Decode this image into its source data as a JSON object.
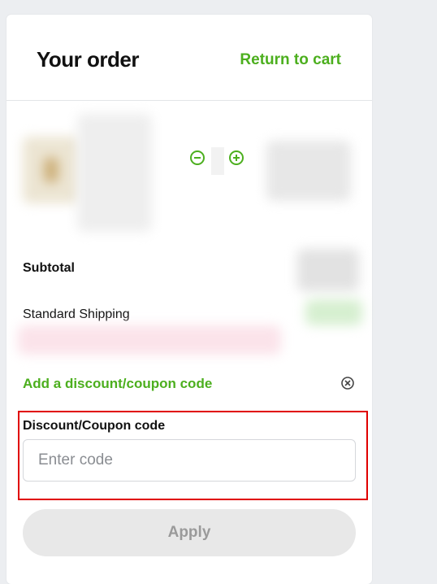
{
  "header": {
    "title": "Your order",
    "return_link": "Return to cart"
  },
  "cart_item": {
    "minus_icon": "minus-circle-icon",
    "plus_icon": "plus-circle-icon"
  },
  "summary": {
    "subtotal_label": "Subtotal",
    "shipping_label": "Standard Shipping"
  },
  "discount": {
    "link_label": "Add a discount/coupon code",
    "close_icon": "close-circle-icon",
    "field_label": "Discount/Coupon code",
    "placeholder": "Enter code",
    "value": "",
    "apply_label": "Apply"
  },
  "colors": {
    "accent": "#4caf1e",
    "highlight_border": "#e00000",
    "background": "#eceef1"
  }
}
